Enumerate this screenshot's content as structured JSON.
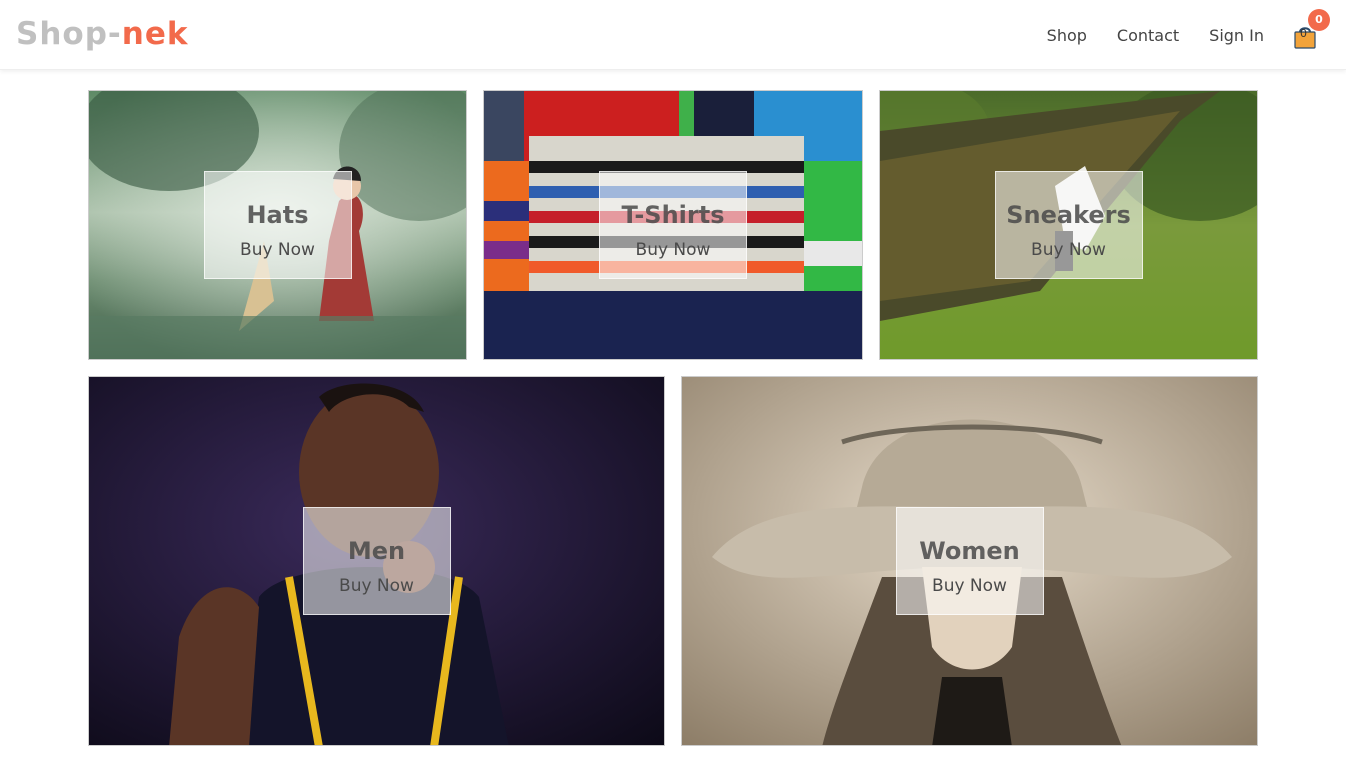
{
  "brand": {
    "part1": "Shop-",
    "part2": "nek"
  },
  "nav": {
    "shop": "Shop",
    "contact": "Contact",
    "sign_in": "Sign In",
    "cart_count": "0",
    "cart_badge": "0",
    "cart_icon": "shopping-bag-icon"
  },
  "colors": {
    "accent": "#f26a4b",
    "logo_gray": "#c0c0c0"
  },
  "categories": [
    {
      "title": "Hats",
      "cta": "Buy Now"
    },
    {
      "title": "T-Shirts",
      "cta": "Buy Now"
    },
    {
      "title": "Sneakers",
      "cta": "Buy Now"
    },
    {
      "title": "Men",
      "cta": "Buy Now"
    },
    {
      "title": "Women",
      "cta": "Buy Now"
    }
  ]
}
